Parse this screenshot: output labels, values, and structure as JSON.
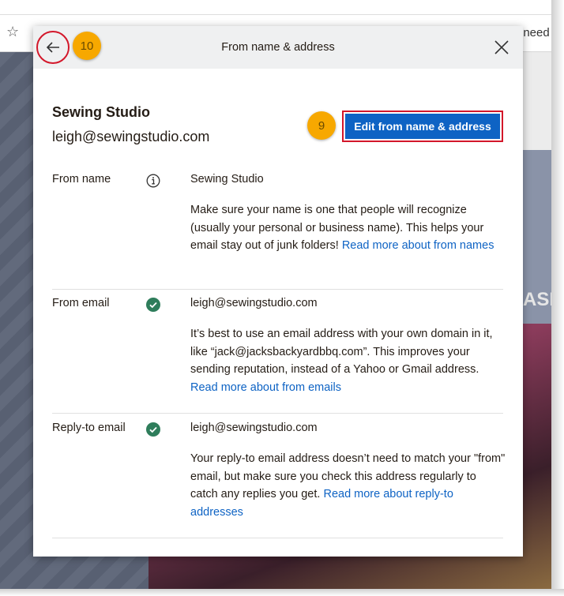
{
  "background": {
    "truncated_text": "t need",
    "side_text": "ASI"
  },
  "modal": {
    "title": "From name & address",
    "account_name": "Sewing Studio",
    "account_email": "leigh@sewingstudio.com",
    "edit_button_label": "Edit from name & address",
    "callouts": {
      "back": "10",
      "edit": "9"
    },
    "rows": [
      {
        "label": "From name",
        "icon": "info-icon",
        "value": "Sewing Studio",
        "description": "Make sure your name is one that people will recognize (usually your personal or business name). This helps your email stay out of junk folders!",
        "link": "Read more about from names"
      },
      {
        "label": "From email",
        "icon": "check-circle-icon",
        "value": "leigh@sewingstudio.com",
        "description": "It’s best to use an email address with your own domain in it, like “jack@jacksbackyardbbq.com”. This improves your sending reputation, instead of a Yahoo or Gmail address.",
        "link": "Read more about from emails"
      },
      {
        "label": "Reply-to email",
        "icon": "check-circle-icon",
        "value": "leigh@sewingstudio.com",
        "description": "Your reply-to email address doesn’t need to match your \"from\" email, but make sure you check this address regularly to catch any replies you get.",
        "link": "Read more about reply-to addresses"
      }
    ]
  },
  "colors": {
    "primary": "#0e63c4",
    "highlight_border": "#d3172a",
    "callout": "#f7a800",
    "verified_green": "#2e7d5b"
  }
}
